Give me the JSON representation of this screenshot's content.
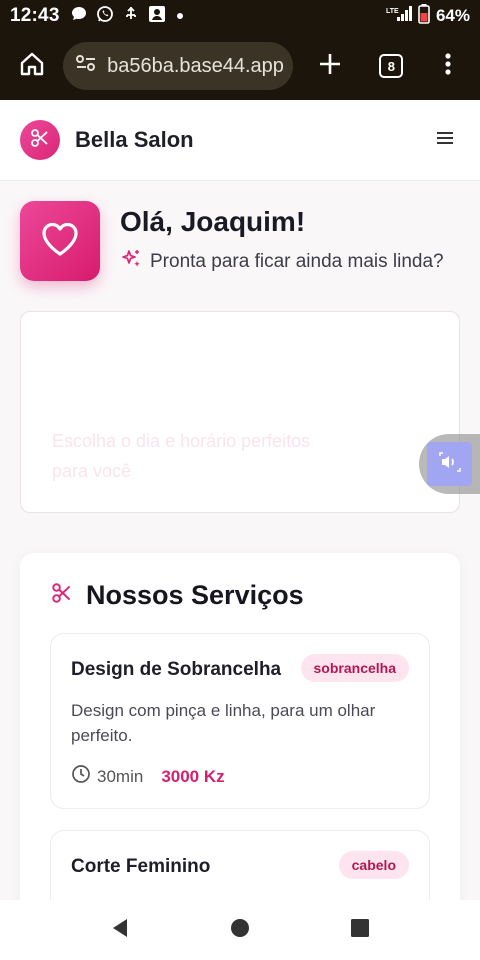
{
  "status_bar": {
    "time": "12:43",
    "battery": "64%",
    "network": "LTE"
  },
  "browser": {
    "url": "ba56ba.base44.app",
    "tab_count": "8"
  },
  "header": {
    "brand": "Bella Salon"
  },
  "greeting": {
    "title": "Olá, Joaquim!",
    "subtitle": "Pronta para ficar ainda mais linda?"
  },
  "hero": {
    "text_line1": "Escolha o dia e horário perfeitos",
    "text_line2": "para você"
  },
  "services": {
    "title": "Nossos Serviços",
    "items": [
      {
        "name": "Design de Sobrancelha",
        "badge": "sobrancelha",
        "description": "Design com pinça e linha, para um olhar perfeito.",
        "duration": "30min",
        "price": "3000 Kz"
      },
      {
        "name": "Corte Feminino",
        "badge": "cabelo"
      }
    ]
  },
  "colors": {
    "accent": "#db2777",
    "accent_light": "#fde4ef",
    "browser_chrome": "#1c150b"
  }
}
